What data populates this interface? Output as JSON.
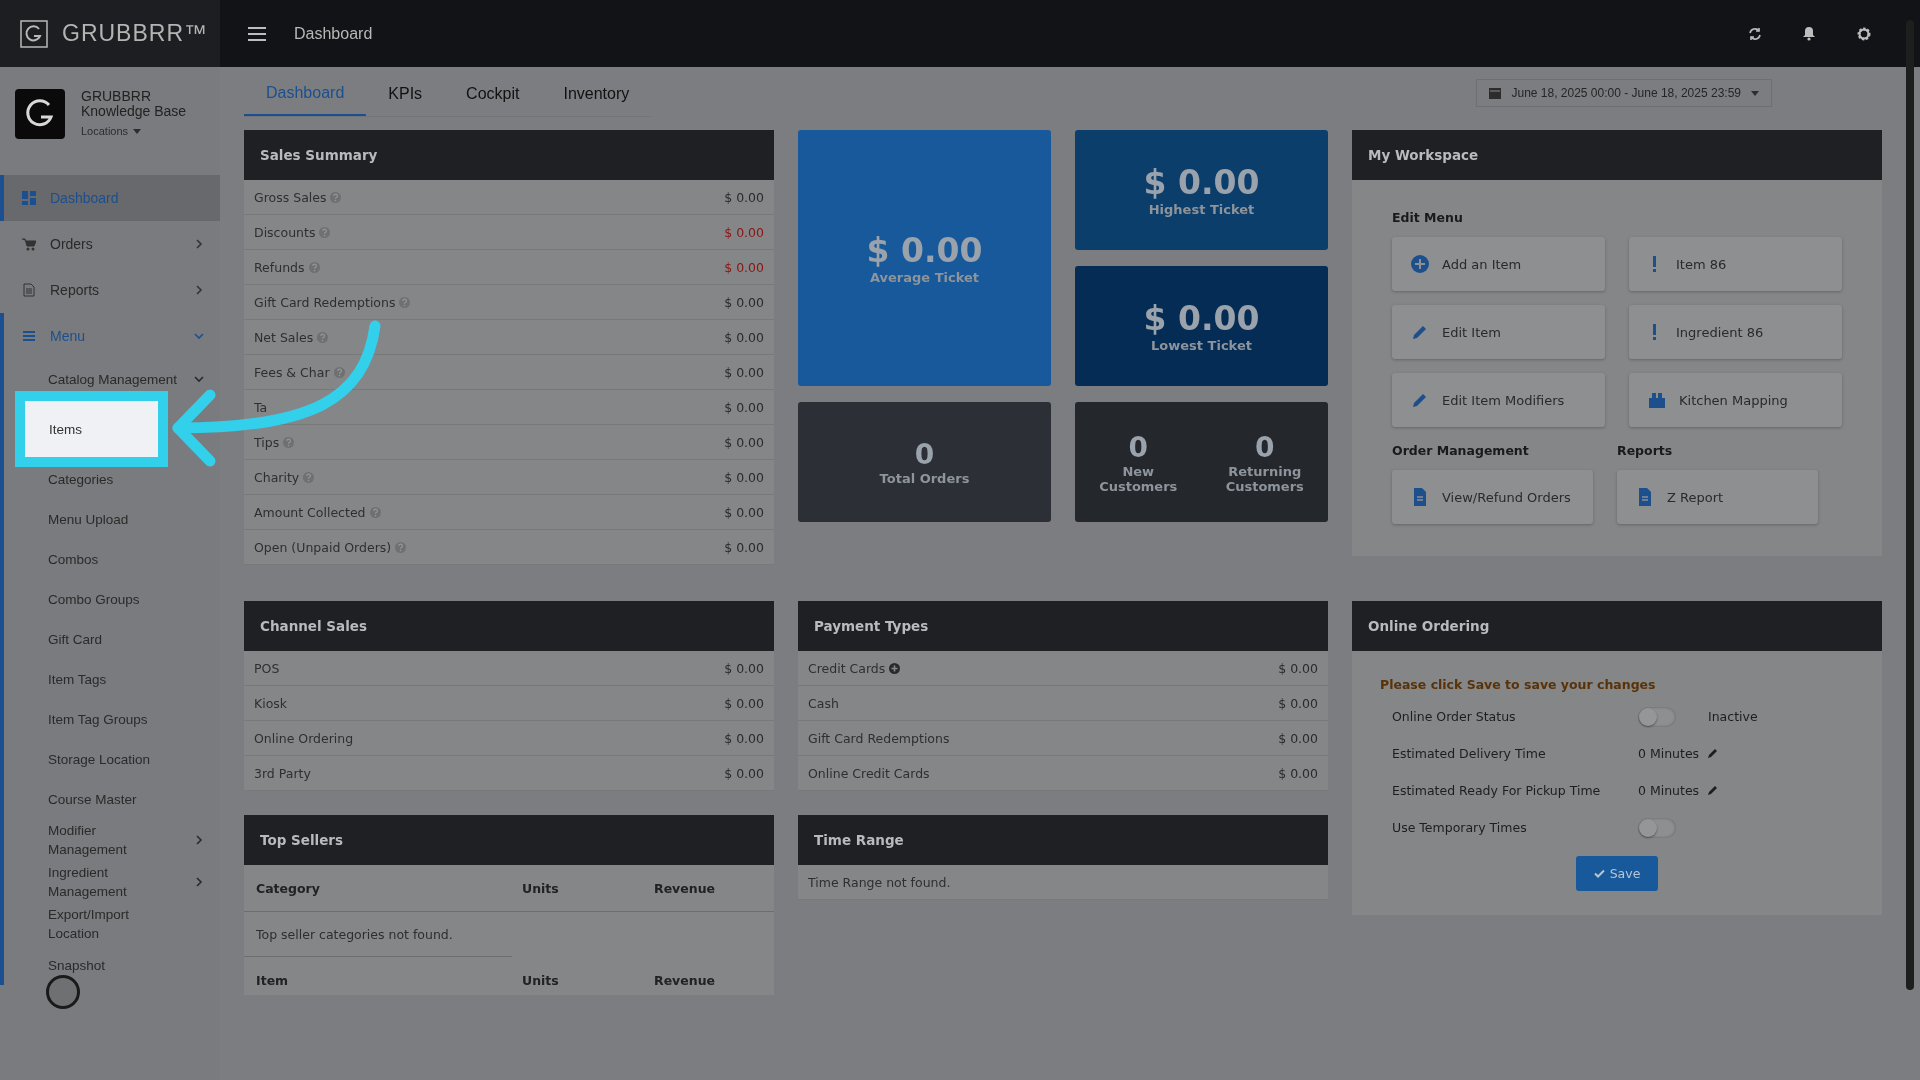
{
  "brand": {
    "name": "GRUBBRR™"
  },
  "topbar": {
    "title": "Dashboard"
  },
  "account": {
    "name": "GRUBBRR Knowledge Base",
    "locations": "Locations"
  },
  "sidebar": {
    "items": [
      {
        "label": "Dashboard",
        "kind": "dashboard",
        "selected": true,
        "has_children": false,
        "expanded": false
      },
      {
        "label": "Orders",
        "kind": "orders",
        "selected": false,
        "has_children": true,
        "expanded": false
      },
      {
        "label": "Reports",
        "kind": "reports",
        "selected": false,
        "has_children": true,
        "expanded": false
      },
      {
        "label": "Menu",
        "kind": "menu",
        "selected": false,
        "has_children": true,
        "expanded": true,
        "children": [
          {
            "label": "Catalog Management",
            "has_children": true,
            "expanded": true,
            "highlighted": false
          },
          {
            "label": "Items",
            "has_children": false,
            "expanded": false,
            "highlighted": true
          },
          {
            "label": "Categories",
            "has_children": false,
            "expanded": false,
            "highlighted": false
          },
          {
            "label": "Menu Upload",
            "has_children": false,
            "expanded": false,
            "highlighted": false
          },
          {
            "label": "Combos",
            "has_children": false,
            "expanded": false,
            "highlighted": false
          },
          {
            "label": "Combo Groups",
            "has_children": false,
            "expanded": false,
            "highlighted": false
          },
          {
            "label": "Gift Card",
            "has_children": false,
            "expanded": false,
            "highlighted": false
          },
          {
            "label": "Item Tags",
            "has_children": false,
            "expanded": false,
            "highlighted": false
          },
          {
            "label": "Item Tag Groups",
            "has_children": false,
            "expanded": false,
            "highlighted": false
          },
          {
            "label": "Storage Location",
            "has_children": false,
            "expanded": false,
            "highlighted": false
          },
          {
            "label": "Course Master",
            "has_children": false,
            "expanded": false,
            "highlighted": false
          },
          {
            "label": "Modifier Management",
            "has_children": true,
            "expanded": false,
            "highlighted": false
          },
          {
            "label": "Ingredient Management",
            "has_children": true,
            "expanded": false,
            "highlighted": false
          },
          {
            "label": "Export/Import Location",
            "has_children": false,
            "expanded": false,
            "highlighted": false
          },
          {
            "label": "Snapshot",
            "has_children": false,
            "expanded": false,
            "highlighted": false
          }
        ]
      }
    ]
  },
  "tabs": [
    {
      "label": "Dashboard",
      "selected": true
    },
    {
      "label": "KPIs",
      "selected": false
    },
    {
      "label": "Cockpit",
      "selected": false
    },
    {
      "label": "Inventory",
      "selected": false
    }
  ],
  "date_range": {
    "label": "June 18, 2025 00:00 - June 18, 2025 23:59"
  },
  "sales_summary": {
    "title": "Sales Summary",
    "rows": [
      {
        "label": "Gross Sales",
        "value": "$ 0.00",
        "negative": false,
        "info": true
      },
      {
        "label": "Discounts",
        "value": "$ 0.00",
        "negative": true,
        "info": true
      },
      {
        "label": "Refunds",
        "value": "$ 0.00",
        "negative": true,
        "info": true
      },
      {
        "label": "Gift Card Redemptions",
        "value": "$ 0.00",
        "negative": false,
        "info": true
      },
      {
        "label": "Net Sales",
        "value": "$ 0.00",
        "negative": false,
        "info": true
      },
      {
        "label": "Fees & Char",
        "value": "$ 0.00",
        "negative": false,
        "info": true
      },
      {
        "label": "Ta",
        "value": "$ 0.00",
        "negative": false,
        "info": false
      },
      {
        "label": "Tips",
        "value": "$ 0.00",
        "negative": false,
        "info": true
      },
      {
        "label": "Charity",
        "value": "$ 0.00",
        "negative": false,
        "info": true
      },
      {
        "label": "Amount Collected",
        "value": "$ 0.00",
        "negative": false,
        "info": true
      },
      {
        "label": "Open (Unpaid Orders)",
        "value": "$ 0.00",
        "negative": false,
        "info": true
      }
    ]
  },
  "tickets": [
    {
      "kind": "average",
      "value": "$ 0.00",
      "label": "Average Ticket"
    },
    {
      "kind": "highest",
      "value": "$ 0.00",
      "label": "Highest Ticket"
    },
    {
      "kind": "lowest",
      "value": "$ 0.00",
      "label": "Lowest Ticket"
    }
  ],
  "total_orders": {
    "value": "0",
    "label": "Total Orders"
  },
  "customers": [
    {
      "value": "0",
      "label": "New Customers"
    },
    {
      "value": "0",
      "label": "Returning Customers"
    }
  ],
  "workspace": {
    "title": "My Workspace",
    "sections": [
      {
        "title": "Edit Menu",
        "kind": "wide",
        "actions": [
          {
            "label": "Add an Item",
            "kind": "add"
          },
          {
            "label": "Item 86",
            "kind": "alert"
          },
          {
            "label": "Edit Item",
            "kind": "edit"
          },
          {
            "label": "Ingredient 86",
            "kind": "alert"
          },
          {
            "label": "Edit Item Modifiers",
            "kind": "edit"
          },
          {
            "label": "Kitchen Mapping",
            "kind": "mapping"
          }
        ]
      },
      {
        "title": "Order Management",
        "kind": "half",
        "actions": [
          {
            "label": "View/Refund Orders",
            "kind": "document"
          }
        ]
      },
      {
        "title": "Reports",
        "kind": "half",
        "actions": [
          {
            "label": "Z Report",
            "kind": "document"
          }
        ]
      }
    ]
  },
  "channel_sales": {
    "title": "Channel Sales",
    "rows": [
      {
        "label": "POS",
        "value": "$ 0.00"
      },
      {
        "label": "Kiosk",
        "value": "$ 0.00"
      },
      {
        "label": "Online Ordering",
        "value": "$ 0.00"
      },
      {
        "label": "3rd Party",
        "value": "$ 0.00"
      }
    ]
  },
  "payment_types": {
    "title": "Payment Types",
    "rows": [
      {
        "label": "Credit Cards",
        "value": "$ 0.00",
        "expandable": true
      },
      {
        "label": "Cash",
        "value": "$ 0.00",
        "expandable": false
      },
      {
        "label": "Gift Card Redemptions",
        "value": "$ 0.00",
        "expandable": false
      },
      {
        "label": "Online Credit Cards",
        "value": "$ 0.00",
        "expandable": false
      }
    ]
  },
  "top_sellers": {
    "title": "Top Sellers",
    "tables": [
      {
        "columns": [
          "Category",
          "Units",
          "Revenue"
        ],
        "empty": "Top seller categories not found."
      },
      {
        "columns": [
          "Item",
          "Units",
          "Revenue"
        ]
      }
    ]
  },
  "time_range": {
    "title": "Time Range",
    "empty": "Time Range not found."
  },
  "online_ordering": {
    "title": "Online Ordering",
    "notice": "Please click Save to save your changes",
    "rows": [
      {
        "kind": "toggle",
        "label": "Online Order Status",
        "on": false,
        "status": "Inactive"
      },
      {
        "kind": "minutes",
        "label": "Estimated Delivery Time",
        "value": "0 Minutes"
      },
      {
        "kind": "minutes",
        "label": "Estimated Ready For Pickup Time",
        "value": "0 Minutes"
      },
      {
        "kind": "toggle",
        "label": "Use Temporary Times",
        "on": false
      }
    ],
    "save": "Save"
  }
}
